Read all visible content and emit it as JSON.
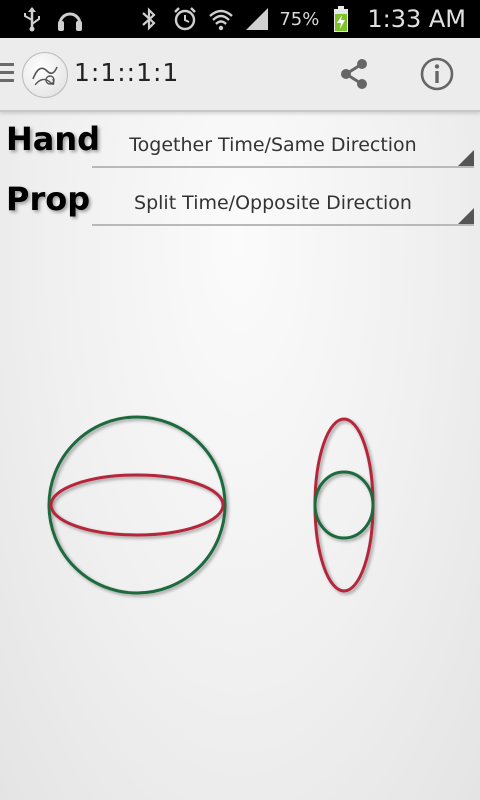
{
  "status_bar": {
    "battery_percent": "75%",
    "time": "1:33 AM",
    "left_icons": [
      "usb-icon",
      "headphones-icon"
    ],
    "right_icons": [
      "bluetooth-icon",
      "alarm-icon",
      "wifi-icon",
      "signal-icon",
      "battery-charging-icon"
    ]
  },
  "action_bar": {
    "title": "1:1::1:1",
    "icons": [
      "drawer-icon",
      "app-logo-icon",
      "share-icon",
      "info-icon"
    ]
  },
  "selectors": {
    "hand": {
      "label": "Hand",
      "value": "Together Time/Same Direction"
    },
    "prop": {
      "label": "Prop",
      "value": "Split Time/Opposite Direction"
    }
  },
  "colors": {
    "green_ring": "#1f6b3d",
    "red_ring": "#b5263a"
  }
}
